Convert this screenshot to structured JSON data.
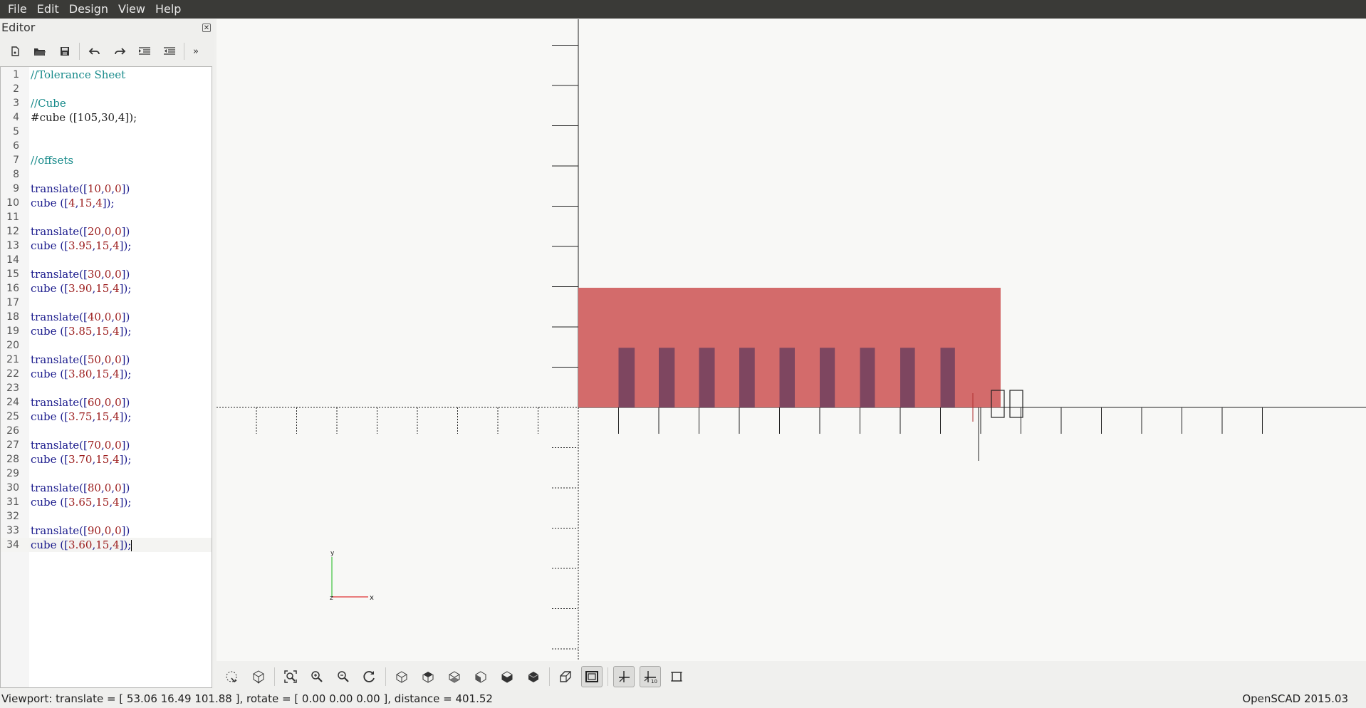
{
  "menu": [
    "File",
    "Edit",
    "Design",
    "View",
    "Help"
  ],
  "editor": {
    "title": "Editor",
    "close_icon": "close-icon",
    "toolbar_icons": [
      "new-file-icon",
      "open-file-icon",
      "save-icon",
      "undo-icon",
      "redo-icon",
      "indent-icon",
      "unindent-icon",
      "more-icon"
    ],
    "lines": [
      [
        [
          "comment",
          "//Tolerance Sheet"
        ]
      ],
      [],
      [
        [
          "comment",
          "//Cube"
        ]
      ],
      [
        [
          "plain",
          "#cube ("
        ],
        [
          "plain",
          "[105,30,4]"
        ],
        [
          "plain",
          ");"
        ]
      ],
      [],
      [],
      [
        [
          "comment",
          "//offsets"
        ]
      ],
      [],
      [
        [
          "kw",
          "translate("
        ],
        [
          "kw",
          "["
        ],
        [
          "num",
          "10"
        ],
        [
          "kw",
          ","
        ],
        [
          "num",
          "0"
        ],
        [
          "kw",
          ","
        ],
        [
          "num",
          "0"
        ],
        [
          "kw",
          "])"
        ]
      ],
      [
        [
          "kw",
          "cube ("
        ],
        [
          "kw",
          "["
        ],
        [
          "num",
          "4"
        ],
        [
          "kw",
          ","
        ],
        [
          "num",
          "15"
        ],
        [
          "kw",
          ","
        ],
        [
          "num",
          "4"
        ],
        [
          "kw",
          "]);"
        ]
      ],
      [],
      [
        [
          "kw",
          "translate("
        ],
        [
          "kw",
          "["
        ],
        [
          "num",
          "20"
        ],
        [
          "kw",
          ","
        ],
        [
          "num",
          "0"
        ],
        [
          "kw",
          ","
        ],
        [
          "num",
          "0"
        ],
        [
          "kw",
          "])"
        ]
      ],
      [
        [
          "kw",
          "cube ("
        ],
        [
          "kw",
          "["
        ],
        [
          "num",
          "3.95"
        ],
        [
          "kw",
          ","
        ],
        [
          "num",
          "15"
        ],
        [
          "kw",
          ","
        ],
        [
          "num",
          "4"
        ],
        [
          "kw",
          "]);"
        ]
      ],
      [],
      [
        [
          "kw",
          "translate("
        ],
        [
          "kw",
          "["
        ],
        [
          "num",
          "30"
        ],
        [
          "kw",
          ","
        ],
        [
          "num",
          "0"
        ],
        [
          "kw",
          ","
        ],
        [
          "num",
          "0"
        ],
        [
          "kw",
          "])"
        ]
      ],
      [
        [
          "kw",
          "cube ("
        ],
        [
          "kw",
          "["
        ],
        [
          "num",
          "3.90"
        ],
        [
          "kw",
          ","
        ],
        [
          "num",
          "15"
        ],
        [
          "kw",
          ","
        ],
        [
          "num",
          "4"
        ],
        [
          "kw",
          "]);"
        ]
      ],
      [],
      [
        [
          "kw",
          "translate("
        ],
        [
          "kw",
          "["
        ],
        [
          "num",
          "40"
        ],
        [
          "kw",
          ","
        ],
        [
          "num",
          "0"
        ],
        [
          "kw",
          ","
        ],
        [
          "num",
          "0"
        ],
        [
          "kw",
          "])"
        ]
      ],
      [
        [
          "kw",
          "cube ("
        ],
        [
          "kw",
          "["
        ],
        [
          "num",
          "3.85"
        ],
        [
          "kw",
          ","
        ],
        [
          "num",
          "15"
        ],
        [
          "kw",
          ","
        ],
        [
          "num",
          "4"
        ],
        [
          "kw",
          "]);"
        ]
      ],
      [],
      [
        [
          "kw",
          "translate("
        ],
        [
          "kw",
          "["
        ],
        [
          "num",
          "50"
        ],
        [
          "kw",
          ","
        ],
        [
          "num",
          "0"
        ],
        [
          "kw",
          ","
        ],
        [
          "num",
          "0"
        ],
        [
          "kw",
          "])"
        ]
      ],
      [
        [
          "kw",
          "cube ("
        ],
        [
          "kw",
          "["
        ],
        [
          "num",
          "3.80"
        ],
        [
          "kw",
          ","
        ],
        [
          "num",
          "15"
        ],
        [
          "kw",
          ","
        ],
        [
          "num",
          "4"
        ],
        [
          "kw",
          "]);"
        ]
      ],
      [],
      [
        [
          "kw",
          "translate("
        ],
        [
          "kw",
          "["
        ],
        [
          "num",
          "60"
        ],
        [
          "kw",
          ","
        ],
        [
          "num",
          "0"
        ],
        [
          "kw",
          ","
        ],
        [
          "num",
          "0"
        ],
        [
          "kw",
          "])"
        ]
      ],
      [
        [
          "kw",
          "cube ("
        ],
        [
          "kw",
          "["
        ],
        [
          "num",
          "3.75"
        ],
        [
          "kw",
          ","
        ],
        [
          "num",
          "15"
        ],
        [
          "kw",
          ","
        ],
        [
          "num",
          "4"
        ],
        [
          "kw",
          "]);"
        ]
      ],
      [],
      [
        [
          "kw",
          "translate("
        ],
        [
          "kw",
          "["
        ],
        [
          "num",
          "70"
        ],
        [
          "kw",
          ","
        ],
        [
          "num",
          "0"
        ],
        [
          "kw",
          ","
        ],
        [
          "num",
          "0"
        ],
        [
          "kw",
          "])"
        ]
      ],
      [
        [
          "kw",
          "cube ("
        ],
        [
          "kw",
          "["
        ],
        [
          "num",
          "3.70"
        ],
        [
          "kw",
          ","
        ],
        [
          "num",
          "15"
        ],
        [
          "kw",
          ","
        ],
        [
          "num",
          "4"
        ],
        [
          "kw",
          "]);"
        ]
      ],
      [],
      [
        [
          "kw",
          "translate("
        ],
        [
          "kw",
          "["
        ],
        [
          "num",
          "80"
        ],
        [
          "kw",
          ","
        ],
        [
          "num",
          "0"
        ],
        [
          "kw",
          ","
        ],
        [
          "num",
          "0"
        ],
        [
          "kw",
          "])"
        ]
      ],
      [
        [
          "kw",
          "cube ("
        ],
        [
          "kw",
          "["
        ],
        [
          "num",
          "3.65"
        ],
        [
          "kw",
          ","
        ],
        [
          "num",
          "15"
        ],
        [
          "kw",
          ","
        ],
        [
          "num",
          "4"
        ],
        [
          "kw",
          "]);"
        ]
      ],
      [],
      [
        [
          "kw",
          "translate("
        ],
        [
          "kw",
          "["
        ],
        [
          "num",
          "90"
        ],
        [
          "kw",
          ","
        ],
        [
          "num",
          "0"
        ],
        [
          "kw",
          ","
        ],
        [
          "num",
          "0"
        ],
        [
          "kw",
          "])"
        ]
      ],
      [
        [
          "kw",
          "cube ("
        ],
        [
          "kw",
          "["
        ],
        [
          "num",
          "3.60"
        ],
        [
          "kw",
          ","
        ],
        [
          "num",
          "15"
        ],
        [
          "kw",
          ","
        ],
        [
          "num",
          "4"
        ],
        [
          "kw",
          "]);"
        ]
      ]
    ],
    "current_line": 34
  },
  "viewport": {
    "sheet_color": "#d36b6b",
    "cutout_color": "#7e4660",
    "axis_labels": {
      "x": "x",
      "y": "y",
      "z": "z"
    }
  },
  "view_toolbar_icons": [
    "preview-icon",
    "render-icon",
    "view-all-icon",
    "zoom-in-icon",
    "zoom-out-icon",
    "reset-view-icon",
    "right-view-icon",
    "top-view-icon",
    "bottom-view-icon",
    "left-view-icon",
    "front-view-icon",
    "back-view-icon",
    "perspective-icon",
    "orthogonal-icon",
    "show-axes-icon",
    "show-scale-markers-icon",
    "show-edges-icon"
  ],
  "status": {
    "viewport": "Viewport: translate = [ 53.06 16.49 101.88 ], rotate = [ 0.00 0.00 0.00 ], distance = 401.52",
    "version": "OpenSCAD 2015.03"
  }
}
